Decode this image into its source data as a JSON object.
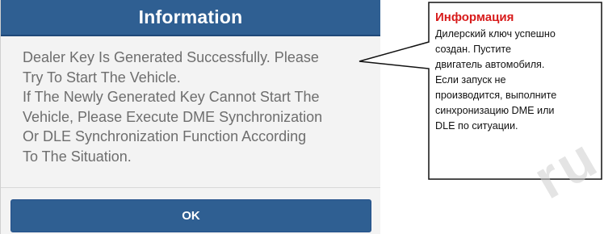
{
  "dialog": {
    "title": "Information",
    "message_lines": [
      "Dealer Key Is Generated Successfully. Please",
      "Try To Start The Vehicle.",
      "If The Newly Generated Key Cannot Start The",
      "Vehicle, Please Execute DME Synchronization",
      "Or DLE Synchronization Function According",
      "To The Situation."
    ],
    "ok_label": "OK"
  },
  "callout": {
    "title": "Информация",
    "lines": [
      "Дилерский ключ успешно",
      "создан. Пустите",
      "двигатель автомобиля.",
      "Если запуск не",
      "производится, выполните",
      "синхронизацию DME или",
      "DLE по ситуации."
    ]
  },
  "watermark": "ru",
  "colors": {
    "header": "#2f5f92",
    "button": "#2f5f92",
    "callout_title": "#d81b1b",
    "dialog_bg": "#f3f3f3"
  }
}
